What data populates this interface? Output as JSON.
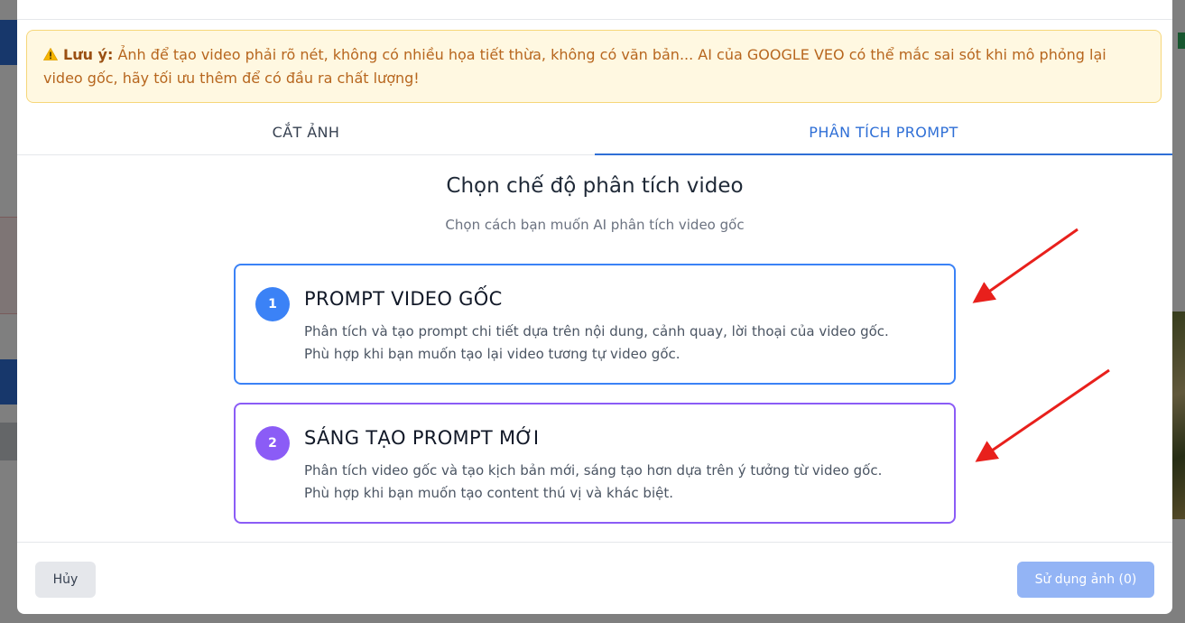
{
  "warning": {
    "label": "Lưu ý:",
    "text": "Ảnh để tạo video phải rõ nét, không có nhiều họa tiết thừa, không có văn bản... AI của GOOGLE VEO có thể mắc sai sót khi mô phỏng lại video gốc, hãy tối ưu thêm để có đầu ra chất lượng!"
  },
  "tabs": [
    {
      "label": "CẮT ẢNH",
      "active": false
    },
    {
      "label": "PHÂN TÍCH PROMPT",
      "active": true
    }
  ],
  "heading": "Chọn chế độ phân tích video",
  "subheading": "Chọn cách bạn muốn AI phân tích video gốc",
  "options": [
    {
      "number": "1",
      "title": "PROMPT VIDEO GỐC",
      "line1": "Phân tích và tạo prompt chi tiết dựa trên nội dung, cảnh quay, lời thoại của video gốc.",
      "line2": "Phù hợp khi bạn muốn tạo lại video tương tự video gốc.",
      "color": "#3b82f6"
    },
    {
      "number": "2",
      "title": "SÁNG TẠO PROMPT MỚI",
      "line1": "Phân tích video gốc và tạo kịch bản mới, sáng tạo hơn dựa trên ý tưởng từ video gốc.",
      "line2": "Phù hợp khi bạn muốn tạo content thú vị và khác biệt.",
      "color": "#8b5cf6"
    }
  ],
  "footer": {
    "cancel_label": "Hủy",
    "use_label": "Sử dụng ảnh (0)"
  },
  "colors": {
    "accent": "#2f6fd6",
    "warning_bg": "#fff8e1",
    "annotation_arrow": "#e8201c"
  }
}
